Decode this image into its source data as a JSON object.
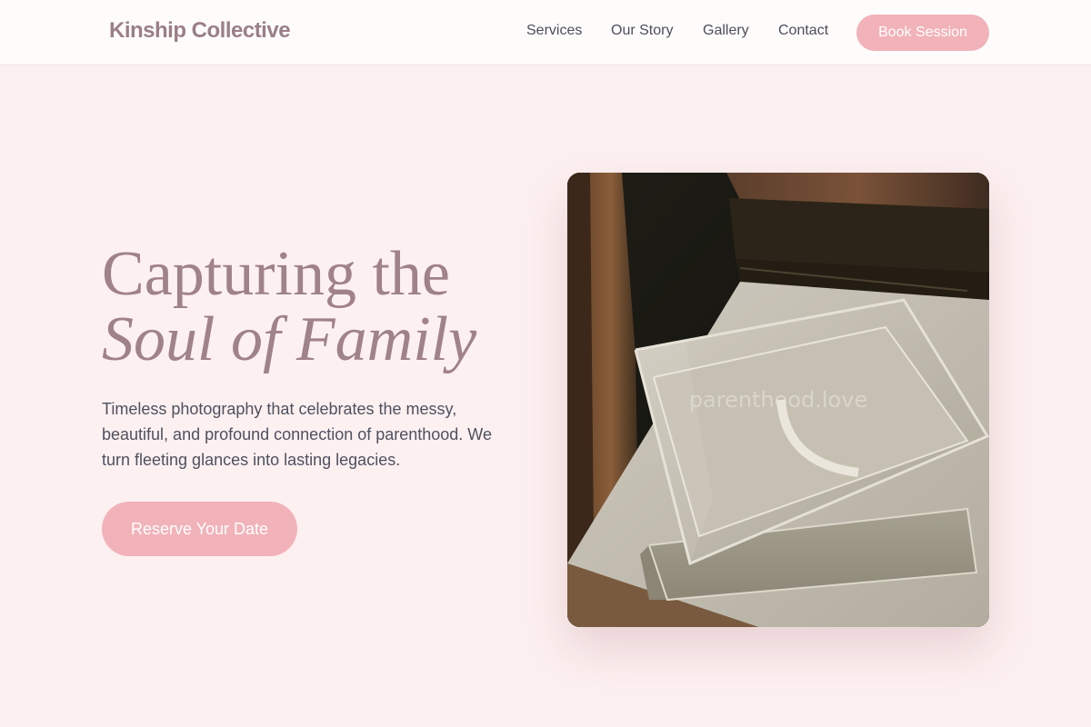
{
  "header": {
    "brand": "Kinship Collective",
    "nav": [
      "Services",
      "Our Story",
      "Gallery",
      "Contact"
    ],
    "cta": "Book Session"
  },
  "hero": {
    "title_line1": "Capturing the",
    "title_line2": "Soul of Family",
    "subtitle": "Timeless photography that celebrates the messy, beautiful, and profound connection of parenthood. We turn fleeting glances into lasting legacies.",
    "cta": "Reserve Your Date",
    "image": {
      "subject": "acrylic keepsake box on a white shelf",
      "watermark": "parenthood.love"
    }
  },
  "colors": {
    "background": "#fdf0f0",
    "accent": "#f2b2b9",
    "brand_text": "#9a7f87",
    "heading": "#a08289",
    "body_text": "#4e5160"
  }
}
